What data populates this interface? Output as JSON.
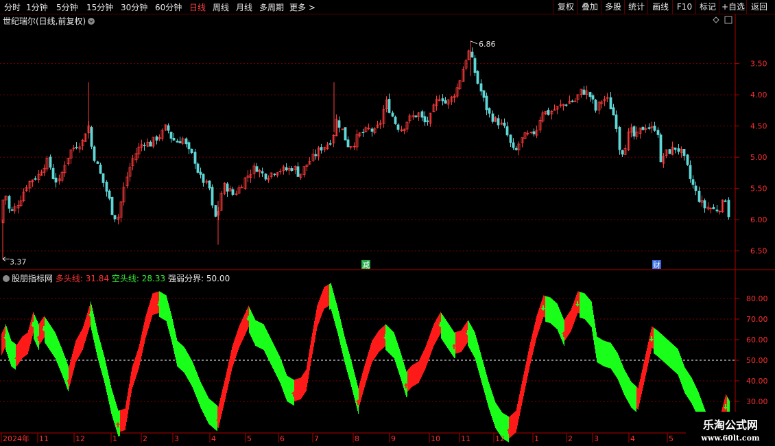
{
  "toolbar": {
    "periods": [
      "分时",
      "1分钟",
      "5分钟",
      "15分钟",
      "30分钟",
      "60分钟",
      "日线",
      "周线",
      "月线",
      "多周期",
      "更多 >"
    ],
    "active_period": "日线",
    "right_buttons": [
      "复权",
      "叠加",
      "多股",
      "统计",
      "画线",
      "F10",
      "标记",
      "+自选",
      "返回"
    ]
  },
  "main_panel": {
    "title": "世纪瑞尔(日线,前复权)",
    "high_label": "6.86",
    "low_label": "3.37",
    "price_ticks": [
      "6.50",
      "6.00",
      "5.50",
      "5.00",
      "4.50",
      "4.00",
      "3.50"
    ],
    "markers": [
      "减",
      "财"
    ]
  },
  "indicator_panel": {
    "name": "股朋指标网",
    "long_label": "多头线:",
    "long_value": "31.84",
    "short_label": "空头线:",
    "short_value": "28.33",
    "bound_label": "强弱分界:",
    "bound_value": "50.00",
    "ticks": [
      "80.00",
      "70.00",
      "60.00",
      "50.00",
      "40.00",
      "30.00"
    ]
  },
  "time_axis": [
    "2024年",
    "11",
    "12",
    "1",
    "2",
    "3",
    "4",
    "5",
    "6",
    "7",
    "8",
    "9",
    "10",
    "11",
    "12",
    "1",
    "2",
    "3",
    "4",
    "5"
  ],
  "watermark": {
    "line1": "乐淘公式网",
    "line2": "www.60lt.com"
  },
  "colors": {
    "up": "#ff2020",
    "down": "#20ff20",
    "cyan": "#5fd7d7",
    "grid": "#7a0000",
    "axis": "#b00000"
  },
  "chart_data": [
    {
      "type": "candlestick",
      "title": "世纪瑞尔(日线,前复权)",
      "ylim": [
        3.2,
        7.1
      ],
      "y_ticks": [
        3.5,
        4.0,
        4.5,
        5.0,
        5.5,
        6.0,
        6.5
      ],
      "x_labels": [
        "2024年",
        "11",
        "12",
        "1",
        "2",
        "3",
        "4",
        "5",
        "6",
        "7",
        "8",
        "9",
        "10",
        "11",
        "12",
        "1",
        "2",
        "3",
        "4",
        "5"
      ],
      "close_path": [
        [
          0,
          3.95
        ],
        [
          6,
          4.5
        ],
        [
          14,
          4.1
        ],
        [
          22,
          4.2
        ],
        [
          30,
          4.35
        ],
        [
          38,
          4.55
        ],
        [
          46,
          4.65
        ],
        [
          55,
          4.7
        ],
        [
          62,
          4.85
        ],
        [
          70,
          4.95
        ],
        [
          78,
          4.65
        ],
        [
          86,
          4.6
        ],
        [
          94,
          4.9
        ],
        [
          102,
          5.1
        ],
        [
          112,
          5.2
        ],
        [
          120,
          5.25
        ],
        [
          128,
          5.55
        ],
        [
          134,
          5.1
        ],
        [
          142,
          4.85
        ],
        [
          150,
          4.6
        ],
        [
          158,
          4.35
        ],
        [
          165,
          4.05
        ],
        [
          172,
          4.05
        ],
        [
          178,
          4.4
        ],
        [
          186,
          4.75
        ],
        [
          194,
          5.0
        ],
        [
          202,
          5.15
        ],
        [
          210,
          5.25
        ],
        [
          218,
          5.2
        ],
        [
          226,
          5.3
        ],
        [
          234,
          5.35
        ],
        [
          242,
          5.5
        ],
        [
          250,
          5.3
        ],
        [
          258,
          5.25
        ],
        [
          266,
          5.3
        ],
        [
          274,
          5.1
        ],
        [
          282,
          5.0
        ],
        [
          290,
          4.7
        ],
        [
          298,
          4.6
        ],
        [
          305,
          4.5
        ],
        [
          312,
          4.0
        ],
        [
          318,
          4.15
        ],
        [
          324,
          4.55
        ],
        [
          332,
          4.5
        ],
        [
          340,
          4.4
        ],
        [
          348,
          4.5
        ],
        [
          356,
          4.65
        ],
        [
          364,
          4.75
        ],
        [
          372,
          4.85
        ],
        [
          380,
          4.75
        ],
        [
          388,
          4.7
        ],
        [
          396,
          4.75
        ],
        [
          404,
          4.8
        ],
        [
          412,
          4.8
        ],
        [
          420,
          4.8
        ],
        [
          428,
          4.85
        ],
        [
          436,
          4.7
        ],
        [
          444,
          4.85
        ],
        [
          452,
          4.95
        ],
        [
          460,
          5.05
        ],
        [
          468,
          5.15
        ],
        [
          476,
          5.2
        ],
        [
          484,
          5.3
        ],
        [
          490,
          5.6
        ],
        [
          498,
          5.45
        ],
        [
          506,
          5.2
        ],
        [
          514,
          5.2
        ],
        [
          522,
          5.35
        ],
        [
          530,
          5.4
        ],
        [
          538,
          5.45
        ],
        [
          546,
          5.4
        ],
        [
          554,
          5.55
        ],
        [
          562,
          5.9
        ],
        [
          570,
          5.7
        ],
        [
          578,
          5.5
        ],
        [
          586,
          5.45
        ],
        [
          594,
          5.6
        ],
        [
          602,
          5.65
        ],
        [
          610,
          5.7
        ],
        [
          618,
          5.55
        ],
        [
          626,
          5.6
        ],
        [
          634,
          5.85
        ],
        [
          642,
          6.0
        ],
        [
          650,
          5.85
        ],
        [
          658,
          5.95
        ],
        [
          666,
          6.1
        ],
        [
          672,
          6.3
        ],
        [
          678,
          6.55
        ],
        [
          684,
          6.7
        ],
        [
          690,
          6.45
        ],
        [
          696,
          6.2
        ],
        [
          704,
          5.95
        ],
        [
          712,
          5.7
        ],
        [
          720,
          5.6
        ],
        [
          728,
          5.55
        ],
        [
          736,
          5.45
        ],
        [
          744,
          5.2
        ],
        [
          750,
          5.05
        ],
        [
          758,
          5.25
        ],
        [
          766,
          5.35
        ],
        [
          774,
          5.35
        ],
        [
          782,
          5.45
        ],
        [
          790,
          5.75
        ],
        [
          798,
          5.7
        ],
        [
          806,
          5.75
        ],
        [
          814,
          5.8
        ],
        [
          822,
          5.85
        ],
        [
          830,
          5.9
        ],
        [
          838,
          5.9
        ],
        [
          846,
          6.05
        ],
        [
          854,
          6.05
        ],
        [
          862,
          5.95
        ],
        [
          868,
          5.75
        ],
        [
          876,
          5.9
        ],
        [
          884,
          5.95
        ],
        [
          892,
          5.75
        ],
        [
          898,
          5.55
        ],
        [
          904,
          5.05
        ],
        [
          910,
          5.15
        ],
        [
          918,
          5.45
        ],
        [
          926,
          5.3
        ],
        [
          934,
          5.45
        ],
        [
          942,
          5.5
        ],
        [
          950,
          5.45
        ],
        [
          958,
          5.5
        ],
        [
          962,
          4.85
        ],
        [
          968,
          5.05
        ],
        [
          976,
          5.1
        ],
        [
          984,
          5.15
        ],
        [
          992,
          5.1
        ],
        [
          1000,
          4.9
        ],
        [
          1006,
          4.65
        ],
        [
          1012,
          4.5
        ],
        [
          1018,
          4.35
        ],
        [
          1026,
          4.2
        ],
        [
          1034,
          4.2
        ],
        [
          1042,
          4.15
        ],
        [
          1050,
          4.2
        ],
        [
          1058,
          4.35
        ],
        [
          1063,
          4.0
        ]
      ],
      "high": 6.86,
      "low": 3.37
    },
    {
      "type": "area",
      "title": "股朋指标网",
      "ylim": [
        15,
        90
      ],
      "y_ticks": [
        30,
        40,
        50,
        60,
        70,
        80
      ],
      "threshold": 50,
      "series": [
        {
          "name": "多头线",
          "value": 31.84
        },
        {
          "name": "空头线",
          "value": 28.33
        }
      ],
      "oscillator": [
        [
          0,
          60
        ],
        [
          8,
          66
        ],
        [
          16,
          58
        ],
        [
          24,
          56
        ],
        [
          32,
          60
        ],
        [
          40,
          62
        ],
        [
          48,
          72
        ],
        [
          56,
          66
        ],
        [
          64,
          70
        ],
        [
          72,
          66
        ],
        [
          80,
          62
        ],
        [
          90,
          54
        ],
        [
          100,
          45
        ],
        [
          110,
          58
        ],
        [
          120,
          64
        ],
        [
          132,
          77
        ],
        [
          142,
          62
        ],
        [
          152,
          50
        ],
        [
          162,
          35
        ],
        [
          172,
          24
        ],
        [
          182,
          25
        ],
        [
          192,
          45
        ],
        [
          202,
          55
        ],
        [
          212,
          70
        ],
        [
          222,
          81
        ],
        [
          232,
          82
        ],
        [
          242,
          80
        ],
        [
          250,
          70
        ],
        [
          258,
          58
        ],
        [
          268,
          55
        ],
        [
          280,
          48
        ],
        [
          292,
          38
        ],
        [
          304,
          30
        ],
        [
          318,
          26
        ],
        [
          328,
          40
        ],
        [
          338,
          55
        ],
        [
          348,
          65
        ],
        [
          362,
          75
        ],
        [
          372,
          68
        ],
        [
          384,
          66
        ],
        [
          396,
          58
        ],
        [
          408,
          50
        ],
        [
          418,
          41
        ],
        [
          428,
          39
        ],
        [
          438,
          40
        ],
        [
          446,
          44
        ],
        [
          454,
          60
        ],
        [
          462,
          75
        ],
        [
          472,
          84
        ],
        [
          482,
          86
        ],
        [
          492,
          74
        ],
        [
          502,
          60
        ],
        [
          512,
          48
        ],
        [
          522,
          35
        ],
        [
          532,
          47
        ],
        [
          542,
          58
        ],
        [
          552,
          63
        ],
        [
          562,
          66
        ],
        [
          574,
          62
        ],
        [
          584,
          52
        ],
        [
          592,
          43
        ],
        [
          600,
          46
        ],
        [
          610,
          48
        ],
        [
          620,
          55
        ],
        [
          632,
          66
        ],
        [
          642,
          72
        ],
        [
          652,
          67
        ],
        [
          662,
          62
        ],
        [
          672,
          63
        ],
        [
          682,
          68
        ],
        [
          692,
          62
        ],
        [
          702,
          50
        ],
        [
          712,
          38
        ],
        [
          722,
          28
        ],
        [
          732,
          23
        ],
        [
          742,
          21
        ],
        [
          752,
          24
        ],
        [
          762,
          40
        ],
        [
          772,
          56
        ],
        [
          782,
          70
        ],
        [
          792,
          80
        ],
        [
          802,
          79
        ],
        [
          812,
          76
        ],
        [
          822,
          68
        ],
        [
          832,
          73
        ],
        [
          842,
          82
        ],
        [
          852,
          81
        ],
        [
          862,
          77
        ],
        [
          870,
          60
        ],
        [
          880,
          58
        ],
        [
          890,
          57
        ],
        [
          900,
          52
        ],
        [
          910,
          44
        ],
        [
          920,
          38
        ],
        [
          930,
          35
        ],
        [
          940,
          50
        ],
        [
          950,
          65
        ],
        [
          958,
          63
        ],
        [
          968,
          60
        ],
        [
          978,
          57
        ],
        [
          988,
          54
        ],
        [
          998,
          45
        ],
        [
          1008,
          40
        ],
        [
          1018,
          33
        ],
        [
          1028,
          24
        ],
        [
          1040,
          17
        ],
        [
          1050,
          22
        ],
        [
          1058,
          32
        ],
        [
          1063,
          29
        ]
      ]
    }
  ]
}
